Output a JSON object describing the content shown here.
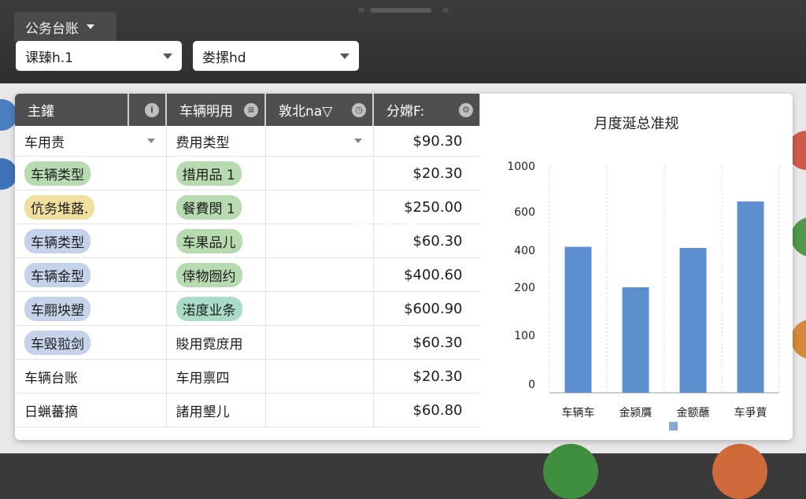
{
  "app_tab": {
    "label": "公务台账"
  },
  "filters": [
    {
      "value": "课臻h.1"
    },
    {
      "value": "娄摞hd"
    }
  ],
  "table": {
    "columns": [
      {
        "label": "主鑵"
      },
      {
        "label": ""
      },
      {
        "label": "车辆明用"
      },
      {
        "label": "敦北na▽"
      },
      {
        "label": "分嫦F:"
      }
    ],
    "filter_row": {
      "col1": "车用责",
      "col3": "费用类型",
      "col5": "$90.30"
    },
    "rows": [
      {
        "col1": "车辆类型",
        "col1_color": "green",
        "col3": "措用品 1",
        "col3_color": "green",
        "col5": "$20.30"
      },
      {
        "col1": "伉务堆蕗.",
        "col1_color": "yellow",
        "col3": "餐費閔 1",
        "col3_color": "green",
        "col5": "$250.00"
      },
      {
        "col1": "车辆类型",
        "col1_color": "blue",
        "col3": "车果品儿",
        "col3_color": "green",
        "col5": "$60.30"
      },
      {
        "col1": "车辆金型",
        "col1_color": "blue",
        "col3": "倖物囫约",
        "col3_color": "green",
        "col5": "$400.60"
      },
      {
        "col1": "车翢坱塑",
        "col1_color": "blue",
        "col3": "渃度业条",
        "col3_color": "teal",
        "col5": "$600.90"
      },
      {
        "col1": "车毁翋剑",
        "col1_color": "blue",
        "col3": "賐用霓庻用",
        "col3_color": "none",
        "col5": "$60.30"
      },
      {
        "col1": "车辆台账",
        "col1_color": "none",
        "col3": "车用禀四",
        "col3_color": "none",
        "col5": "$20.30"
      },
      {
        "col1": "日蝋蕃摘",
        "col1_color": "none",
        "col3": "諸用墾儿",
        "col3_color": "none",
        "col5": "$60.80"
      }
    ]
  },
  "chart_data": {
    "type": "bar",
    "title": "月度涎总准规",
    "categories": [
      "车辆车",
      "金颍贋",
      "金额蘸",
      "车爭蕒"
    ],
    "values": [
      418,
      200,
      412,
      690
    ],
    "yticks": [
      0,
      100,
      200,
      400,
      600,
      1000
    ],
    "color": "#5b8fcf",
    "legend": "bottom-center"
  },
  "watermark": {
    "main": "K73",
    "sub": "游戏之家"
  },
  "colors": {
    "pill_green": "#b8dab0",
    "pill_yellow": "#f1df9e",
    "pill_blue": "#c4d3ea",
    "pill_teal": "#a9dcc6"
  }
}
